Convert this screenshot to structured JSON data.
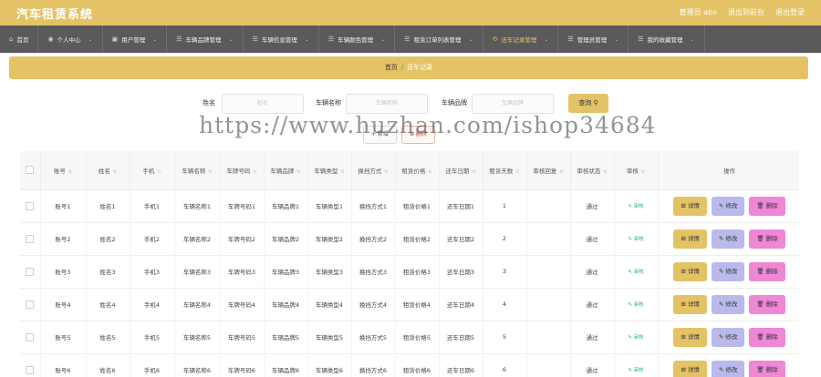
{
  "header": {
    "brand": "汽车租赁系统",
    "admin": "管理员 abo",
    "back": "退出到前台",
    "logout": "退出登录"
  },
  "nav": [
    {
      "icon": "home-icon",
      "glyph": "⌂",
      "label": "首页",
      "dropdown": false
    },
    {
      "icon": "user-icon",
      "glyph": "◉",
      "label": "个人中心",
      "dropdown": true
    },
    {
      "icon": "users-icon",
      "glyph": "▣",
      "label": "用户管理",
      "dropdown": true
    },
    {
      "icon": "list-icon",
      "glyph": "☰",
      "label": "车辆品牌管理",
      "dropdown": true
    },
    {
      "icon": "list-icon",
      "glyph": "☰",
      "label": "车辆信息管理",
      "dropdown": true
    },
    {
      "icon": "list-icon",
      "glyph": "☰",
      "label": "车辆颜色管理",
      "dropdown": true
    },
    {
      "icon": "list-icon",
      "glyph": "☰",
      "label": "租赁订单列表管理",
      "dropdown": true
    },
    {
      "icon": "return-icon",
      "glyph": "⟲",
      "label": "还车记录管理",
      "dropdown": true,
      "active": true
    },
    {
      "icon": "list-icon",
      "glyph": "☰",
      "label": "管理员管理",
      "dropdown": true
    },
    {
      "icon": "list-icon",
      "glyph": "☰",
      "label": "我的收藏管理",
      "dropdown": true
    }
  ],
  "breadcrumb": {
    "home": "首页",
    "sep": "/",
    "current": "还车记录"
  },
  "search": {
    "name_label": "姓名",
    "name_placeholder": "姓名",
    "car_label": "车辆名称",
    "car_placeholder": "车辆名称",
    "brand_label": "车辆品牌",
    "brand_placeholder": "车辆品牌",
    "button": "查询 ⚲"
  },
  "actions": {
    "add": "+ 新增",
    "delete": "⊗ 删除"
  },
  "watermark": "https://www.huzhan.com/ishop34684",
  "table": {
    "columns": [
      "账号",
      "姓名",
      "手机",
      "车辆名称",
      "车牌号码",
      "车辆品牌",
      "车辆类型",
      "换挡方式",
      "租赁价格",
      "还车日期",
      "租赁天数",
      "审核回复",
      "审核状态",
      "审核",
      "操作"
    ],
    "sortable": [
      true,
      true,
      true,
      true,
      true,
      true,
      true,
      true,
      true,
      true,
      true,
      true,
      true,
      true,
      false
    ],
    "rows": [
      {
        "account": "账号1",
        "name": "姓名1",
        "phone": "手机1",
        "car": "车辆名称1",
        "plate": "车牌号码1",
        "brand": "车辆品牌1",
        "type": "车辆类型1",
        "gear": "换挡方式1",
        "price": "租赁价格1",
        "date": "还车日期1",
        "days": "1",
        "reply": "",
        "status": "通过",
        "audit": "✎ 审核"
      },
      {
        "account": "账号2",
        "name": "姓名2",
        "phone": "手机2",
        "car": "车辆名称2",
        "plate": "车牌号码2",
        "brand": "车辆品牌2",
        "type": "车辆类型2",
        "gear": "换挡方式2",
        "price": "租赁价格2",
        "date": "还车日期2",
        "days": "2",
        "reply": "",
        "status": "通过",
        "audit": "✎ 审核"
      },
      {
        "account": "账号3",
        "name": "姓名3",
        "phone": "手机3",
        "car": "车辆名称3",
        "plate": "车牌号码3",
        "brand": "车辆品牌3",
        "type": "车辆类型3",
        "gear": "换挡方式3",
        "price": "租赁价格3",
        "date": "还车日期3",
        "days": "3",
        "reply": "",
        "status": "通过",
        "audit": "✎ 审核"
      },
      {
        "account": "账号4",
        "name": "姓名4",
        "phone": "手机4",
        "car": "车辆名称4",
        "plate": "车牌号码4",
        "brand": "车辆品牌4",
        "type": "车辆类型4",
        "gear": "换挡方式4",
        "price": "租赁价格4",
        "date": "还车日期4",
        "days": "4",
        "reply": "",
        "status": "通过",
        "audit": "✎ 审核"
      },
      {
        "account": "账号5",
        "name": "姓名5",
        "phone": "手机5",
        "car": "车辆名称5",
        "plate": "车牌号码5",
        "brand": "车辆品牌5",
        "type": "车辆类型5",
        "gear": "换挡方式5",
        "price": "租赁价格5",
        "date": "还车日期5",
        "days": "5",
        "reply": "",
        "status": "通过",
        "audit": "✎ 审核"
      },
      {
        "account": "账号6",
        "name": "姓名6",
        "phone": "手机6",
        "car": "车辆名称6",
        "plate": "车牌号码6",
        "brand": "车辆品牌6",
        "type": "车辆类型6",
        "gear": "换挡方式6",
        "price": "租赁价格6",
        "date": "还车日期6",
        "days": "6",
        "reply": "",
        "status": "通过",
        "audit": "✎ 审核"
      }
    ],
    "ops": {
      "detail": "⊞ 详情",
      "edit": "✎ 修改",
      "delete": "🗑 删除"
    }
  },
  "colors": {
    "accent": "#e4c366",
    "nav": "#5a5a5a",
    "edit": "#b9b9ec",
    "delete": "#ef86d6",
    "audit": "#2eae9c"
  }
}
